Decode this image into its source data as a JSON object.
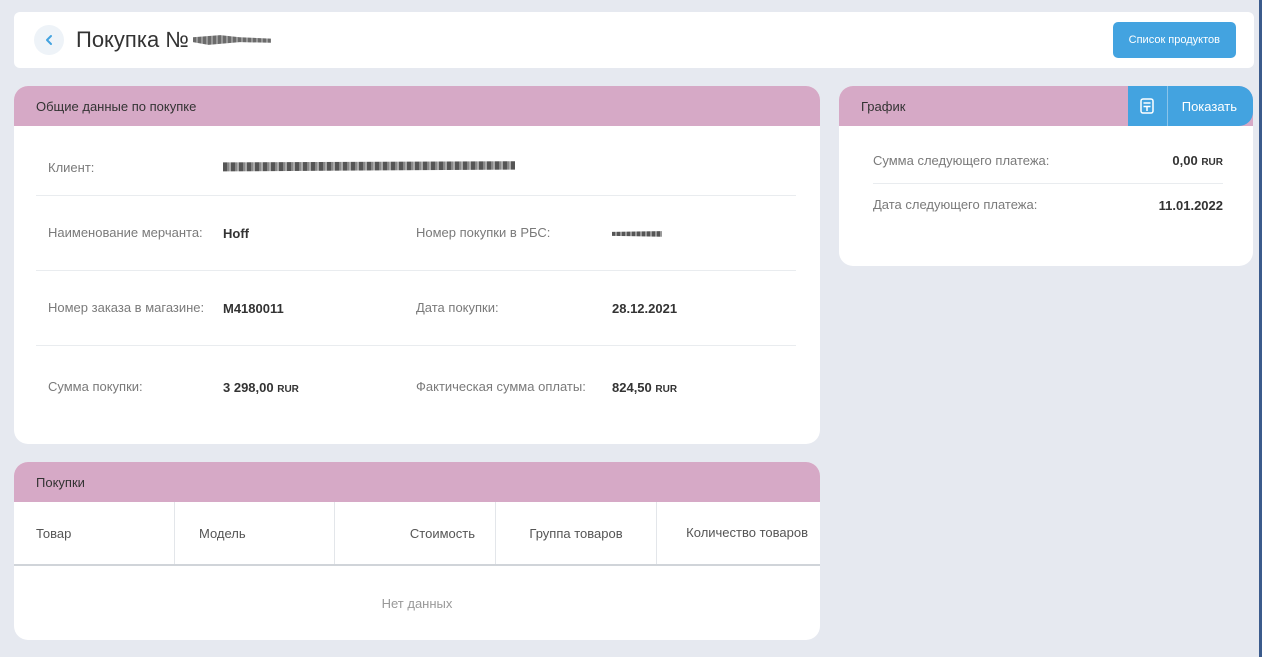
{
  "header": {
    "title": "Покупка №",
    "products_button": "Список продуктов"
  },
  "general": {
    "section_title": "Общие данные по покупке",
    "client_label": "Клиент:",
    "merchant_label": "Наименование мерчанта:",
    "merchant_value": "Hoff",
    "rbs_label": "Номер покупки в РБС:",
    "order_label": "Номер заказа в магазине:",
    "order_value": "M4180011",
    "date_label": "Дата покупки:",
    "date_value": "28.12.2021",
    "sum_label": "Сумма покупки:",
    "sum_value": "3 298,00",
    "actual_label": "Фактическая сумма оплаты:",
    "actual_value": "824,50",
    "currency": "RUR"
  },
  "graph": {
    "section_title": "График",
    "show_button": "Показать",
    "next_sum_label": "Сумма следующего платежа:",
    "next_sum_value": "0,00",
    "next_date_label": "Дата следующего платежа:",
    "next_date_value": "11.01.2022",
    "currency": "RUR"
  },
  "purchases": {
    "section_title": "Покупки",
    "columns": [
      "Товар",
      "Модель",
      "Стоимость",
      "Группа товаров",
      "Количество товаров"
    ],
    "empty_text": "Нет данных"
  },
  "icons": {
    "back": "chevron-left-icon",
    "calculator": "calculator-icon"
  },
  "colors": {
    "accent": "#43a3e0",
    "section_header": "#d6a9c6",
    "background": "#e6e9f0"
  }
}
